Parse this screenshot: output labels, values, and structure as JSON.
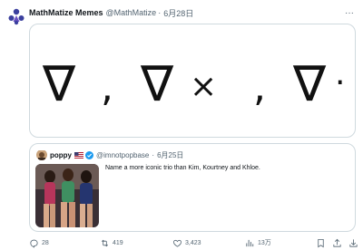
{
  "post": {
    "author_name": "MathMatize Memes",
    "handle": "@MathMatize",
    "separator": "·",
    "date": "6月28日",
    "more_label": "···",
    "media": {
      "symbols": [
        "∇",
        ",",
        "∇",
        "×",
        ",",
        "∇",
        "·"
      ]
    }
  },
  "quote": {
    "author_name": "poppy",
    "handle": "@imnotpopbase",
    "separator": "·",
    "date": "6月25日",
    "text": "Name a more iconic trio than Kim, Kourtney and Khloe."
  },
  "actions": {
    "replies": "28",
    "reposts": "419",
    "likes": "3,423",
    "views": "13万"
  },
  "colors": {
    "text": "#0f1419",
    "secondary": "#536471",
    "border": "#cfd9de",
    "verified": "#1d9bf0"
  },
  "icons": [
    "user-avatar-logo-icon",
    "more-icon",
    "flag-us-icon",
    "verified-badge-icon",
    "reply-icon",
    "repost-icon",
    "like-icon",
    "views-icon",
    "bookmark-icon",
    "share-icon"
  ]
}
